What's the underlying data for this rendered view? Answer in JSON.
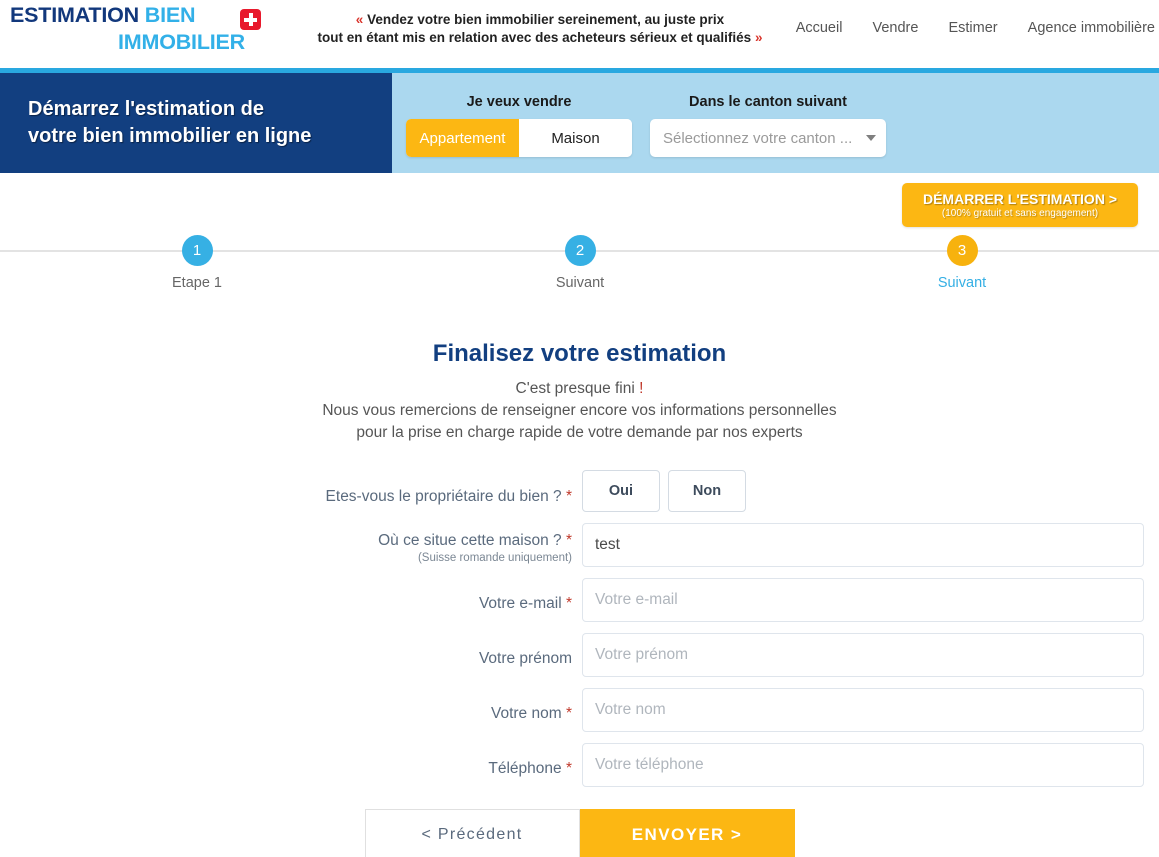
{
  "header": {
    "logo": {
      "word1": "ESTIMATION",
      "word2": "BIEN",
      "word3": "IMMOBILIER"
    },
    "flag_icon": "swiss-flag-icon",
    "tagline_line1": "Vendez votre bien immobilier sereinement, au juste prix",
    "tagline_line2": "tout en étant mis en relation avec des acheteurs sérieux et qualifiés",
    "guillemet_open": "«",
    "guillemet_close": "»",
    "nav": [
      {
        "label": "Accueil"
      },
      {
        "label": "Vendre"
      },
      {
        "label": "Estimer"
      },
      {
        "label": "Agence immobilière"
      }
    ]
  },
  "banner": {
    "headline_line1": "Démarrez l'estimation de",
    "headline_line2": "votre bien immobilier en ligne",
    "sell_label": "Je veux vendre",
    "property_types": [
      {
        "label": "Appartement",
        "selected": true
      },
      {
        "label": "Maison",
        "selected": false
      }
    ],
    "canton_label": "Dans le canton suivant",
    "canton_placeholder": "Sélectionnez votre canton ...",
    "cta_main": "DÉMARRER L'ESTIMATION >",
    "cta_sub": "(100% gratuit et sans engagement)",
    "accent_blue": "#123f80",
    "accent_lightblue": "#abd8ef",
    "accent_yellow": "#fcb713",
    "accent_cyan": "#29a8e0"
  },
  "stepper": {
    "steps": [
      {
        "number": "1",
        "label": "Etape 1",
        "color": "#36b0e4",
        "active": false
      },
      {
        "number": "2",
        "label": "Suivant",
        "color": "#36b0e4",
        "active": false
      },
      {
        "number": "3",
        "label": "Suivant",
        "color": "#f7b20e",
        "active": true
      }
    ]
  },
  "form": {
    "title": "Finalisez votre estimation",
    "sub_line1": "C'est presque fini ",
    "sub_line1_bang": "!",
    "sub_line2": "Nous vous remercions de renseigner encore vos informations personnelles",
    "sub_line3": "pour la prise en charge rapide de votre demande par nos experts",
    "required_mark": "*",
    "fields": {
      "owner": {
        "label": "Etes-vous le propriétaire du bien ?",
        "options": [
          {
            "label": "Oui"
          },
          {
            "label": "Non"
          }
        ]
      },
      "location": {
        "label": "Où ce situe cette maison ?",
        "sublabel": "(Suisse romande uniquement)",
        "value": "test",
        "placeholder": ""
      },
      "email": {
        "label": "Votre e-mail",
        "value": "",
        "placeholder": "Votre e-mail"
      },
      "firstname": {
        "label": "Votre prénom",
        "value": "",
        "placeholder": "Votre prénom"
      },
      "lastname": {
        "label": "Votre nom",
        "value": "",
        "placeholder": "Votre nom"
      },
      "phone": {
        "label": "Téléphone",
        "value": "",
        "placeholder": "Votre téléphone"
      }
    },
    "prev_button": "< Précédent",
    "submit_button": "ENVOYER >"
  }
}
